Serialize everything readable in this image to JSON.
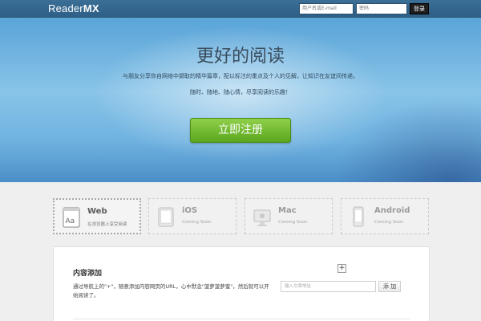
{
  "header": {
    "logo_regular": "Reader",
    "logo_bold": "MX",
    "username_placeholder": "用户名或E-mail",
    "password_placeholder": "密码",
    "login_label": "登录"
  },
  "hero": {
    "title": "更好的阅读",
    "line1": "与朋友分享你自网络中撷取的精华篇章，配以标注的重点及个人的见解，让知识在友谊间传递。",
    "line2": "随时、随地、随心情，尽享阅读的乐趣！",
    "signup_label": "立即注册"
  },
  "platforms": [
    {
      "name": "Web",
      "desc": "在浏览器上享受阅读",
      "icon": "web-browser-icon"
    },
    {
      "name": "iOS",
      "desc": "Coming Soon",
      "icon": "ipad-icon"
    },
    {
      "name": "Mac",
      "desc": "Coming Soon",
      "icon": "mac-monitor-icon"
    },
    {
      "name": "Android",
      "desc": "Coming Soon",
      "icon": "android-phone-icon"
    }
  ],
  "content": {
    "title": "内容添加",
    "description": "通过导航上的\"+\"，随意添加内容网页的URL，心中默念\"菠萝菠萝蜜\"，然后就可以开始阅读了。",
    "plus_symbol": "+",
    "url_placeholder": "输入文章地址",
    "add_label": "添 加"
  },
  "colors": {
    "topbar": "#2f5f86",
    "hero_blue": "#6fb2e0",
    "signup_green": "#6db82c"
  }
}
